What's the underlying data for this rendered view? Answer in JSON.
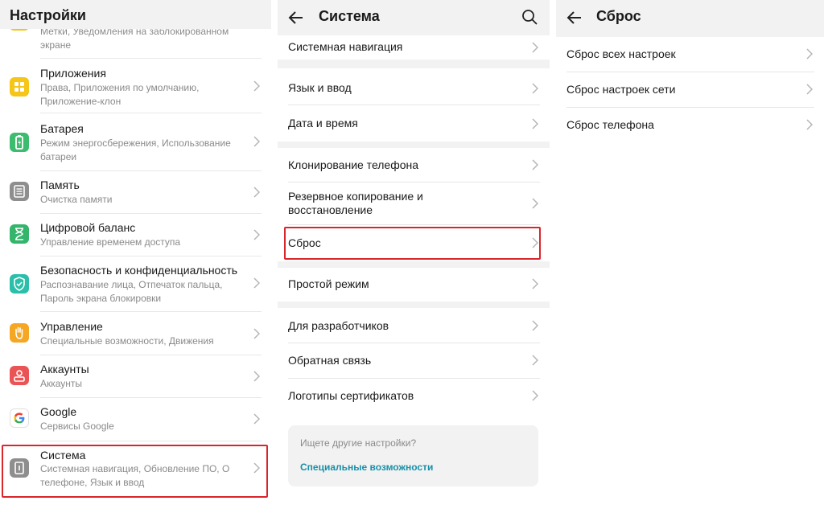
{
  "settings": {
    "title": "Настройки",
    "top_partial": {
      "line1": "Метки, Уведомления на заблокированном",
      "line2": "экране"
    },
    "items": [
      {
        "title": "Приложения",
        "sub1": "Права, Приложения по умолчанию,",
        "sub2": "Приложение-клон",
        "icon": "apps-icon",
        "color": "#f5c518"
      },
      {
        "title": "Батарея",
        "sub1": "Режим энергосбережения, Использование",
        "sub2": "батареи",
        "icon": "battery-icon",
        "color": "#3dbb6e"
      },
      {
        "title": "Память",
        "sub1": "Очистка памяти",
        "sub2": "",
        "icon": "storage-icon",
        "color": "#8e8e8e"
      },
      {
        "title": "Цифровой баланс",
        "sub1": "Управление временем доступа",
        "sub2": "",
        "icon": "hourglass-icon",
        "color": "#35b46b"
      },
      {
        "title": "Безопасность и конфиденциальность",
        "sub1": "Распознавание лица, Отпечаток пальца,",
        "sub2": "Пароль экрана блокировки",
        "icon": "shield-icon",
        "color": "#2bbfa9"
      },
      {
        "title": "Управление",
        "sub1": "Специальные возможности, Движения",
        "sub2": "",
        "icon": "hand-icon",
        "color": "#f5a623"
      },
      {
        "title": "Аккаунты",
        "sub1": "Аккаунты",
        "sub2": "",
        "icon": "account-icon",
        "color": "#ea5455"
      },
      {
        "title": "Google",
        "sub1": "Сервисы Google",
        "sub2": "",
        "icon": "google-icon",
        "color": "#ffffff"
      },
      {
        "title": "Система",
        "sub1": "Системная навигация, Обновление ПО, О",
        "sub2": "телефоне, Язык и ввод",
        "icon": "system-icon",
        "color": "#8e8e8e"
      }
    ]
  },
  "system": {
    "title": "Система",
    "items": {
      "nav": "Системная навигация",
      "lang": "Язык и ввод",
      "datetime": "Дата и время",
      "clone": "Клонирование телефона",
      "backup1": "Резервное копирование и",
      "backup2": "восстановление",
      "reset": "Сброс",
      "simple": "Простой режим",
      "dev": "Для разработчиков",
      "feedback": "Обратная связь",
      "certs": "Логотипы сертификатов"
    },
    "hint": {
      "question": "Ищете другие настройки?",
      "link": "Специальные возможности"
    }
  },
  "reset": {
    "title": "Сброс",
    "items": [
      "Сброс всех настроек",
      "Сброс настроек сети",
      "Сброс телефона"
    ]
  },
  "colors": {
    "highlight": "#d9262c",
    "link": "#1a8fa8"
  }
}
